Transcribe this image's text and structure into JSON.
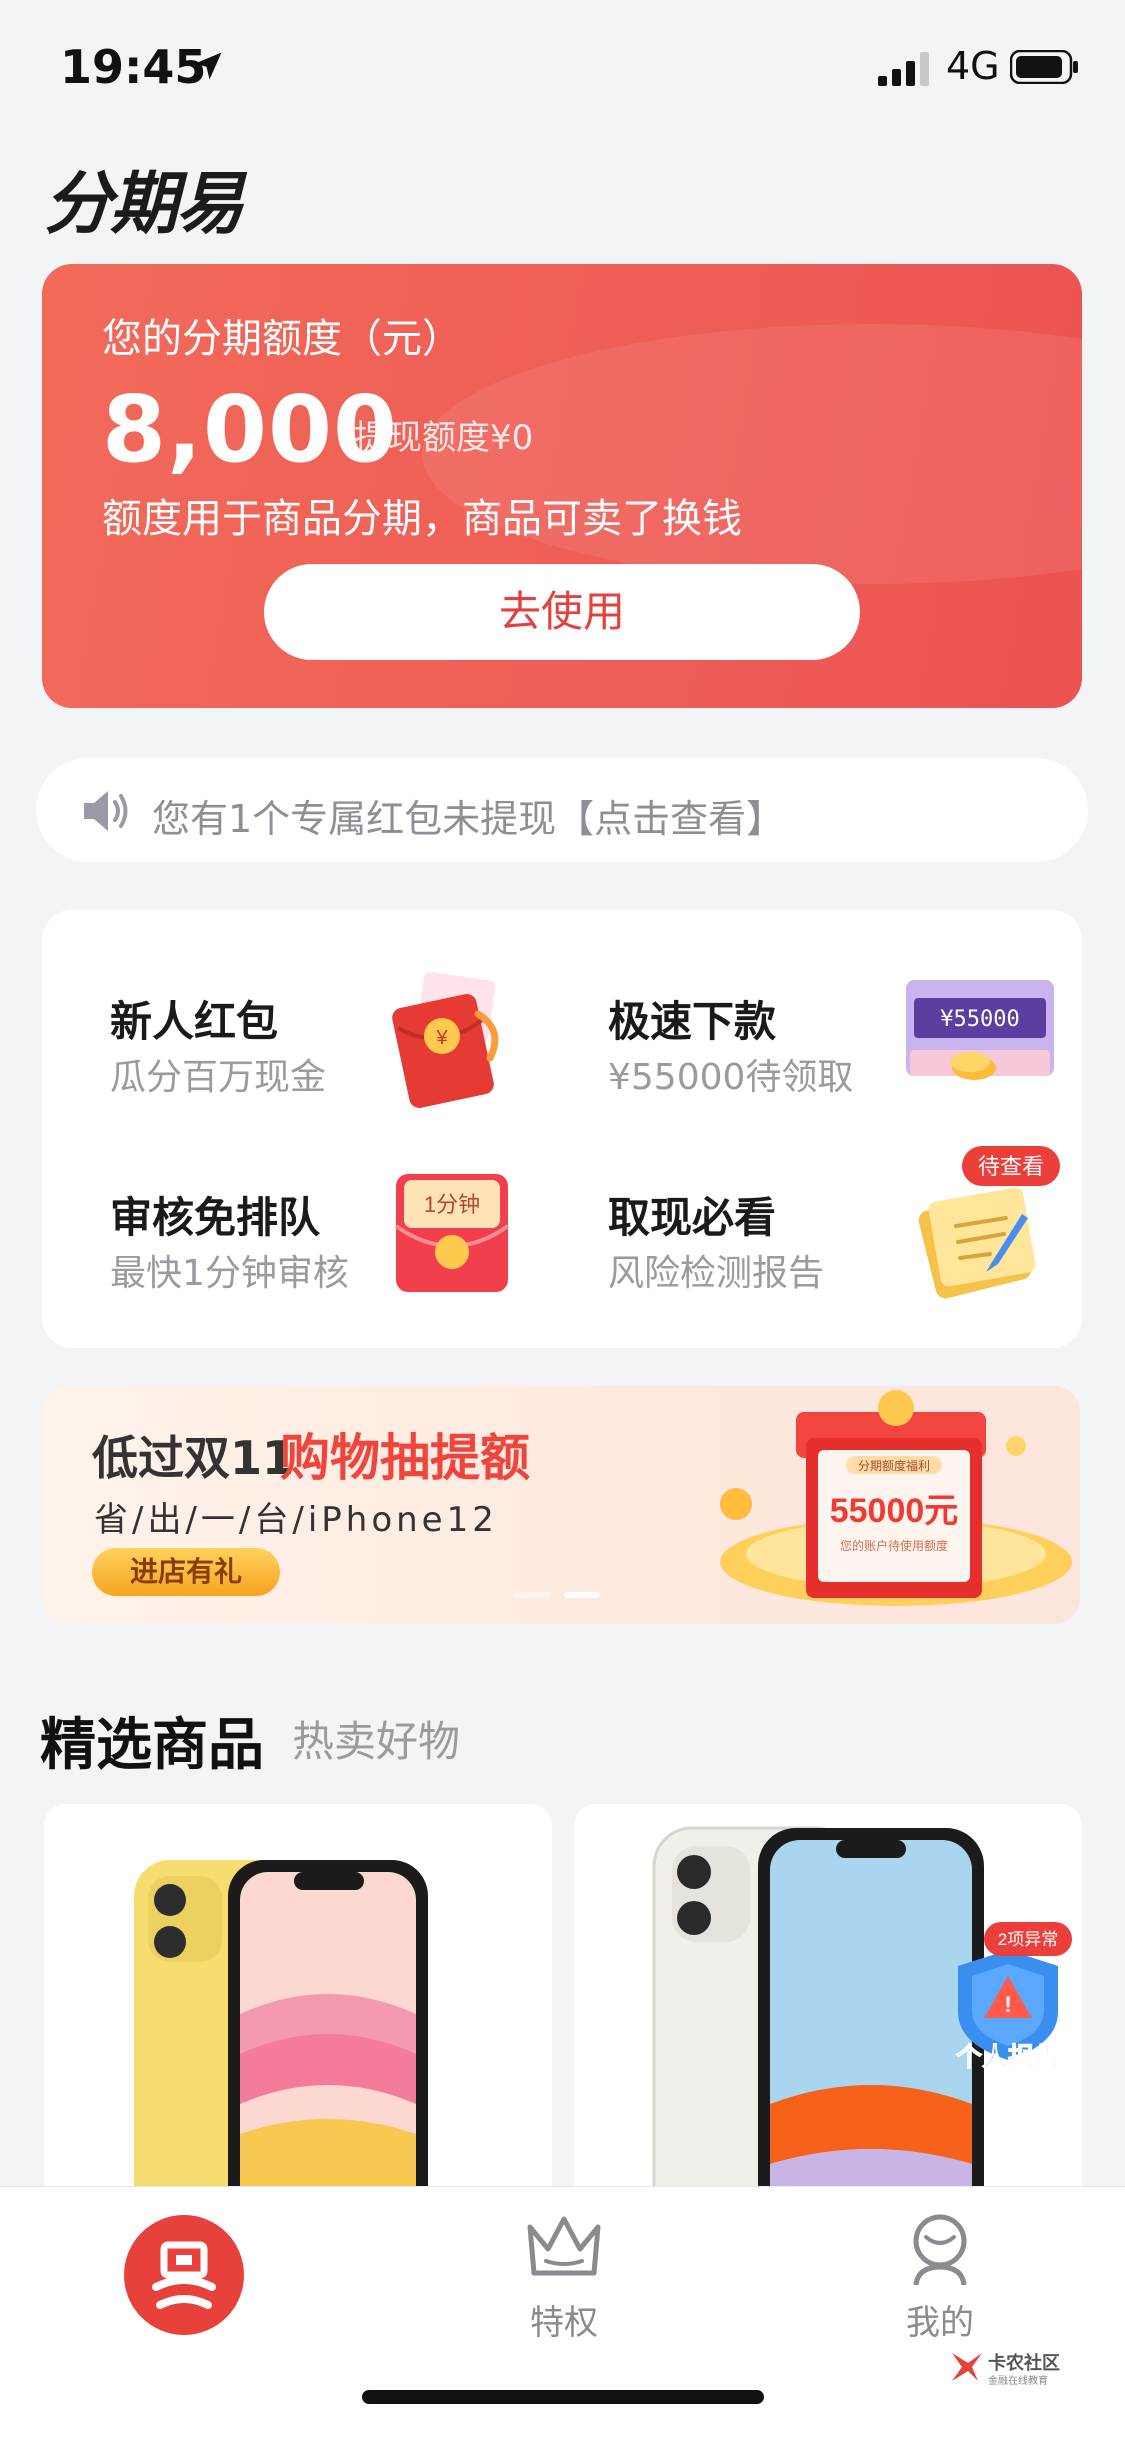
{
  "status_bar": {
    "time": "19:45",
    "network": "4G"
  },
  "app": {
    "title": "分期易"
  },
  "credit": {
    "label": "您的分期额度（元）",
    "amount": "8,000",
    "withdraw_label": "提现额度¥0",
    "description": "额度用于商品分期，商品可卖了换钱",
    "use_button": "去使用"
  },
  "notice": {
    "text": "您有1个专属红包未提现【点击查看】"
  },
  "features": [
    {
      "title": "新人红包",
      "subtitle": "瓜分百万现金",
      "icon": "red-envelope-icon"
    },
    {
      "title": "极速下款",
      "subtitle": "¥55000待领取",
      "icon": "cash-machine-icon",
      "counter": "¥55000"
    },
    {
      "title": "审核免排队",
      "subtitle": "最快1分钟审核",
      "icon": "one-minute-envelope-icon",
      "badge_text": "1分钟"
    },
    {
      "title": "取现必看",
      "subtitle": "风险检测报告",
      "icon": "report-notepad-icon",
      "tag": "待查看"
    }
  ],
  "banner": {
    "title_part1": "低过双11",
    "title_part2": "购物抽提额",
    "subtitle": "省/出/一/台/iPhone12",
    "button": "进店有礼",
    "art_heading": "分期额度福利",
    "art_amount": "55000元",
    "art_note": "您的账户待使用额度"
  },
  "section": {
    "title": "精选商品",
    "subtitle": "热卖好物"
  },
  "products": [
    {
      "color": "#f9e27a",
      "name": "yellow-phone"
    },
    {
      "color": "#f3f1ec",
      "name": "white-phone"
    }
  ],
  "report_badge": {
    "tag": "2项异常",
    "label": "个人报告"
  },
  "bottom_nav": {
    "items": [
      {
        "label": "",
        "icon": "home-logo-icon"
      },
      {
        "label": "特权",
        "icon": "crown-icon"
      },
      {
        "label": "我的",
        "icon": "user-icon"
      }
    ]
  },
  "watermark": {
    "text": "卡农社区",
    "subtext": "金融在线教育"
  },
  "colors": {
    "accent": "#ec5352",
    "background": "#f3f4f6"
  }
}
